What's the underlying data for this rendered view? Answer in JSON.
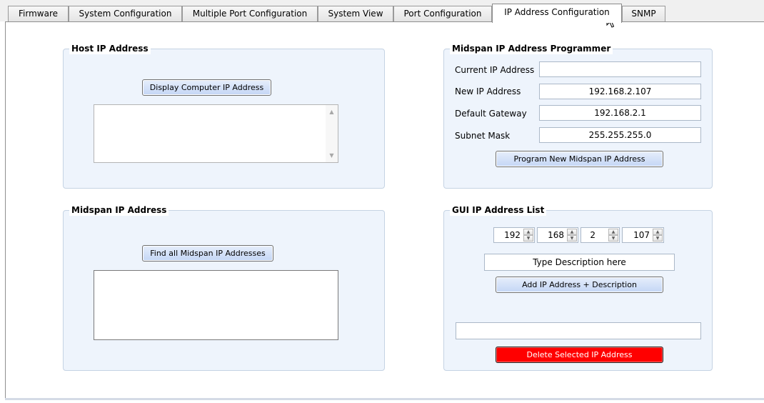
{
  "tabs": [
    {
      "label": "Firmware"
    },
    {
      "label": "System Configuration"
    },
    {
      "label": "Multiple Port Configuration"
    },
    {
      "label": "System View"
    },
    {
      "label": "Port Configuration"
    },
    {
      "label": "IP Address Configuration",
      "active": true
    },
    {
      "label": "SNMP"
    }
  ],
  "host_ip": {
    "title": "Host IP Address",
    "display_button": "Display Computer IP Address"
  },
  "midspan_ip": {
    "title": "Midspan IP Address",
    "find_button": "Find all Midspan IP Addresses"
  },
  "programmer": {
    "title": "Midspan IP Address Programmer",
    "current_label": "Current IP Address",
    "current_value": "",
    "new_label": "New IP Address",
    "new_value": "192.168.2.107",
    "gateway_label": "Default Gateway",
    "gateway_value": "192.168.2.1",
    "mask_label": "Subnet Mask",
    "mask_value": "255.255.255.0",
    "program_button": "Program New Midspan IP Address"
  },
  "gui_list": {
    "title": "GUI IP Address List",
    "octets": [
      "192",
      "168",
      "2",
      "107"
    ],
    "description_value": "Type Description here",
    "add_button": "Add IP Address + Description",
    "selected_value": "",
    "delete_button": "Delete Selected IP Address"
  },
  "colors": {
    "delete_button": "#ff0000",
    "group_background": "#eef4fc",
    "button_gradient_top": "#e6eefb",
    "button_gradient_bottom": "#c4d6f5"
  },
  "icons": {
    "cursor": "arrow-pointer-icon",
    "scroll_up": "scroll-up-arrow-icon",
    "scroll_down": "scroll-down-arrow-icon",
    "spin_up": "spin-up-icon",
    "spin_down": "spin-down-icon"
  }
}
